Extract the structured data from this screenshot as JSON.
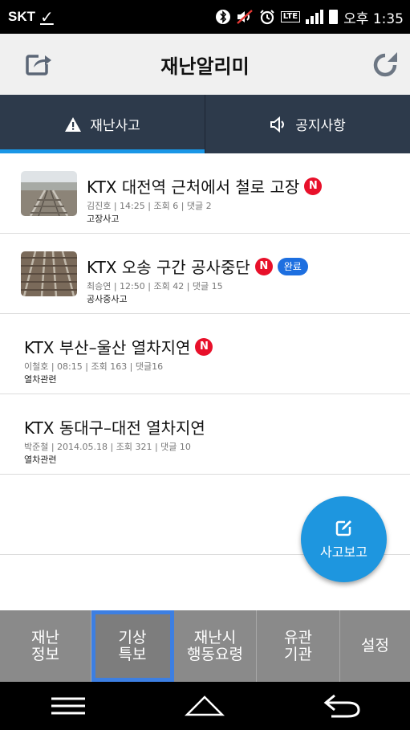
{
  "status_bar": {
    "carrier": "SKT",
    "carrier_mark": "✓",
    "time": "오후 1:35",
    "network": "LTE",
    "icons": [
      "bluetooth-icon",
      "mute-icon",
      "alarm-icon",
      "lte-icon",
      "signal-icon",
      "battery-icon"
    ]
  },
  "header": {
    "title": "재난알리미",
    "left_icon": "share-icon",
    "right_icon": "refresh-icon"
  },
  "tabs": [
    {
      "label": "재난사고",
      "icon": "warning-icon",
      "active": true
    },
    {
      "label": "공지사항",
      "icon": "speaker-icon",
      "active": false
    }
  ],
  "list": [
    {
      "title": "KTX 대전역 근처에서 철로 고장",
      "new_badge": "N",
      "status_badge": "",
      "meta": "김진호 | 14:25 | 조회 6 | 댓글 2",
      "category": "고장사고",
      "has_thumb": true
    },
    {
      "title": "KTX 오송 구간 공사중단",
      "new_badge": "N",
      "status_badge": "완료",
      "meta": "최승연 | 12:50 | 조회 42 | 댓글 15",
      "category": "공사중사고",
      "has_thumb": true
    },
    {
      "title": "KTX 부산–울산 열차지연",
      "new_badge": "N",
      "status_badge": "",
      "meta": "이철호 | 08:15 | 조회 163 | 댓글16",
      "category": "열차관련",
      "has_thumb": false
    },
    {
      "title": "KTX 동대구–대전 열차지연",
      "new_badge": "",
      "status_badge": "",
      "meta": "박준철 | 2014.05.18 | 조회 321 | 댓글 10",
      "category": "열차관련",
      "has_thumb": false
    }
  ],
  "fab": {
    "label": "사고보고",
    "icon": "edit-icon"
  },
  "bottom_menu": [
    {
      "line1": "재난",
      "line2": "정보",
      "selected": false
    },
    {
      "line1": "기상",
      "line2": "특보",
      "selected": true
    },
    {
      "line1": "재난시",
      "line2": "행동요령",
      "selected": false
    },
    {
      "line1": "유관",
      "line2": "기관",
      "selected": false
    },
    {
      "line1": "설정",
      "line2": "",
      "selected": false
    }
  ],
  "nav_bar": [
    "menu-icon",
    "home-icon",
    "back-icon"
  ],
  "colors": {
    "tab_bar": "#2d3a4b",
    "tab_indicator": "#1a96e6",
    "new_badge": "#e8102a",
    "done_badge": "#1d6fe0",
    "fab": "#1e96df",
    "bottom_menu": "#8a8a8a",
    "selection_outline": "#3d7fe2"
  }
}
